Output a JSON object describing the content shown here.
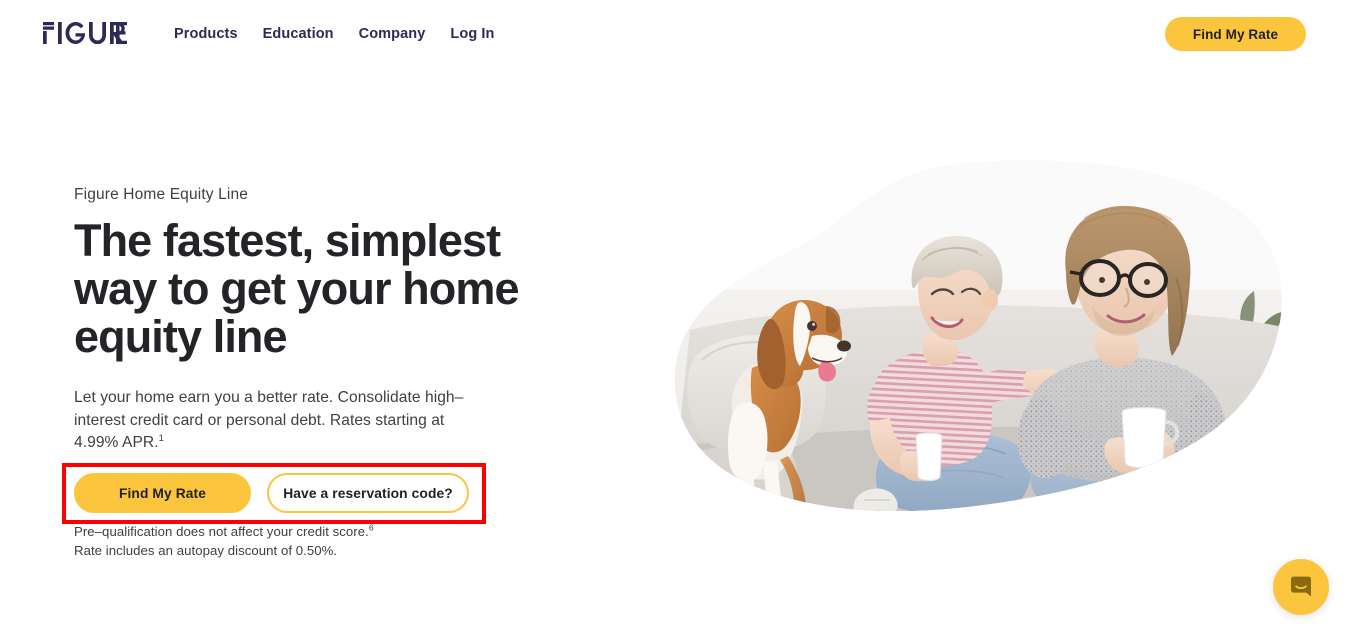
{
  "header": {
    "logo_text": "FIGURE",
    "logo_icon": "figure-wordmark",
    "nav_items": [
      {
        "label": "Products"
      },
      {
        "label": "Education"
      },
      {
        "label": "Company"
      },
      {
        "label": "Log In"
      }
    ],
    "cta_label": "Find My Rate"
  },
  "hero": {
    "eyebrow": "Figure Home Equity Line",
    "headline": "The fastest, simplest way to get your home equity line",
    "subcopy": "Let your home earn you a better rate. Consolidate high–interest credit card or personal debt. Rates starting at 4.99% APR.",
    "subcopy_footnote": "1",
    "primary_cta": "Find My Rate",
    "secondary_cta": "Have a reservation code?",
    "fineprint_line1": "Pre–qualification does not affect your credit score.",
    "fineprint_line1_footnote": "6",
    "fineprint_line2": "Rate includes an autopay discount of 0.50%.",
    "image_alt": "Couple sitting on a sofa with a beagle, holding mugs"
  },
  "chat": {
    "icon": "chat-bubble-smile-icon",
    "label": "Open chat"
  },
  "annotation": {
    "highlight_color": "#ff0000",
    "target": "cta-row"
  },
  "colors": {
    "brand_yellow": "#fbc63e",
    "navy": "#2e2a58",
    "text_dark": "#232427",
    "text_body": "#3e4045",
    "annotation_red": "#ff0000"
  }
}
